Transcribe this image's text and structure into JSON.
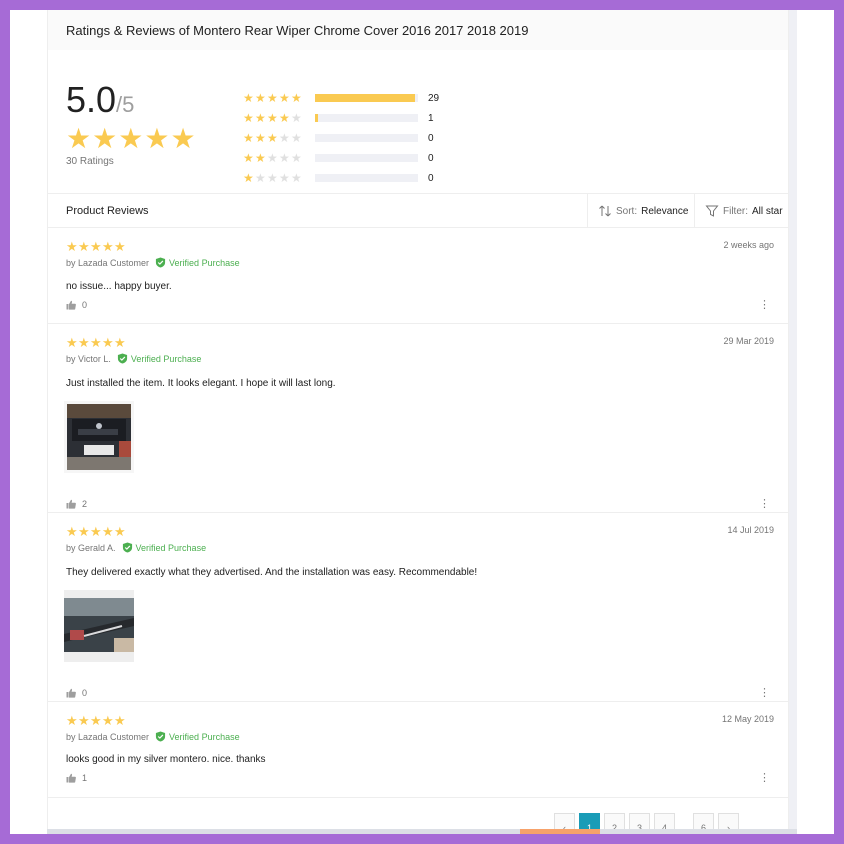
{
  "header": {
    "title": "Ratings & Reviews of Montero Rear Wiper Chrome Cover 2016 2017 2018 2019"
  },
  "summary": {
    "score": "5.0",
    "score_denominator": "/5",
    "ratings_count": "30 Ratings",
    "distribution": [
      {
        "stars": 5,
        "count": "29",
        "fraction": 0.967
      },
      {
        "stars": 4,
        "count": "1",
        "fraction": 0.033
      },
      {
        "stars": 3,
        "count": "0",
        "fraction": 0
      },
      {
        "stars": 2,
        "count": "0",
        "fraction": 0
      },
      {
        "stars": 1,
        "count": "0",
        "fraction": 0
      }
    ]
  },
  "filterbar": {
    "label": "Product Reviews",
    "sort_label": "Sort:",
    "sort_value": "Relevance",
    "filter_label": "Filter:",
    "filter_value": "All star"
  },
  "reviews": [
    {
      "rating": 5,
      "date": "2 weeks ago",
      "author": "by Lazada Customer",
      "verified": "Verified Purchase",
      "text": "no issue... happy buyer.",
      "likes": "0"
    },
    {
      "rating": 5,
      "date": "29 Mar 2019",
      "author": "by Victor L.",
      "verified": "Verified Purchase",
      "text": "Just installed the item. It looks elegant. I hope it will last long.",
      "likes": "2"
    },
    {
      "rating": 5,
      "date": "14 Jul 2019",
      "author": "by Gerald A.",
      "verified": "Verified Purchase",
      "text": "They delivered exactly what they advertised. And the installation was easy. Recommendable!",
      "likes": "0"
    },
    {
      "rating": 5,
      "date": "12 May 2019",
      "author": "by Lazada Customer",
      "verified": "Verified Purchase",
      "text": "looks good in my silver montero. nice. thanks",
      "likes": "1"
    }
  ],
  "pagination": {
    "prev": "‹",
    "pages": [
      "1",
      "2",
      "3",
      "4"
    ],
    "ellipsis": "",
    "last": "6",
    "next": "›",
    "current": "1"
  },
  "colors": {
    "star": "#faca51",
    "star_off": "#e0e0e0",
    "verified": "#4caf50",
    "accent": "#1a9cb7"
  }
}
